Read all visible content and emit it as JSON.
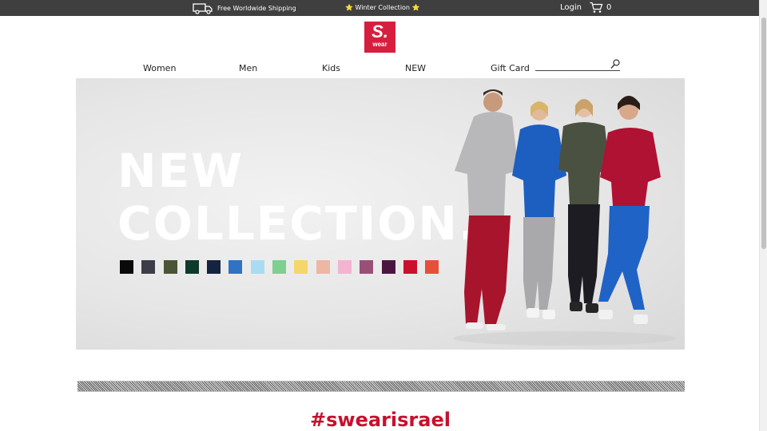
{
  "topbar": {
    "shipping_text": "Free Worldwide Shipping",
    "winter_text": "Winter Collection",
    "star_glyph": "⭐",
    "login_label": "Login",
    "cart_count": "0"
  },
  "logo": {
    "letter": "S.",
    "word": "wear",
    "color": "#d61f3e"
  },
  "nav": {
    "items": [
      "Women",
      "Men",
      "Kids",
      "NEW",
      "Gift Card"
    ]
  },
  "search": {
    "placeholder": "",
    "icon": "search-icon"
  },
  "hero": {
    "line1": "NEW",
    "line2": "COLLECTION.",
    "swatch_colors": [
      "#0a0a0a",
      "#3c3d48",
      "#4a5436",
      "#0e3a2c",
      "#14233f",
      "#2f73c2",
      "#a9dcf3",
      "#7fcf91",
      "#f5d66a",
      "#edb7a3",
      "#f2b4d1",
      "#9a4f77",
      "#4a1641",
      "#c9102d",
      "#e5503b"
    ]
  },
  "hashtag": "#swearisrael",
  "colors": {
    "topbar": "#3f3f3f",
    "brand_red": "#c8102e"
  }
}
